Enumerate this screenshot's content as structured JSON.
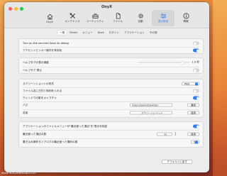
{
  "window": {
    "title": "OnyX"
  },
  "colors": {
    "close": "#ff5f57",
    "minimize": "#febc2e",
    "zoom": "#28c840",
    "accent": "#2e7df6"
  },
  "toolbar": {
    "items": [
      {
        "label": "OnyX",
        "icon": "house-icon"
      },
      {
        "label": "メンテナンス",
        "icon": "tools-icon"
      },
      {
        "label": "ユーティリティ",
        "icon": "toolbox-icon"
      },
      {
        "label": "ファイル",
        "icon": "document-icon"
      },
      {
        "label": "自動",
        "icon": "gear-icon"
      },
      {
        "label": "表示設定",
        "icon": "sliders-icon",
        "selected": true
      },
      {
        "label": "情報",
        "icon": "info-icon"
      }
    ]
  },
  "tabs": [
    {
      "label": "一般",
      "active": true
    },
    {
      "label": "Finder"
    },
    {
      "label": "メニュー"
    },
    {
      "label": "Dock"
    },
    {
      "label": "ログイン"
    },
    {
      "label": "アプリケーション"
    },
    {
      "label": "その他"
    }
  ],
  "section1": {
    "show_secured_label": "Turn on the secured Save As dialog",
    "color_picker_label": "アクセントピッカー値外を有効化",
    "show_secured_on": false,
    "color_picker_on": true
  },
  "section2": {
    "hide_delay_label": "ヘルプタグの表示速度",
    "hide_delay_value": "1.0 秒",
    "hide_delay_level": 0.88,
    "help_viewer_label": "ヘルプタグ 停止",
    "help_viewer_on": false
  },
  "section3": {
    "format_label": "スクリーンショットの形式",
    "format_value": "PNG",
    "include_date_label": "ファイル名に日付と時刻を入れる",
    "include_date_on": false,
    "shadow_label": "ウインドウの影をキャプチャ",
    "shadow_on": true,
    "path_label": "パス",
    "path_value": "/Users/Sams/Desktop/",
    "path_button": "選択",
    "name_label": "名前",
    "name_value": "スクリーンショット",
    "name_button": "適用"
  },
  "section4": {
    "app_menu_label": "アプリケーションのファイルメニューが\"最近使った項目\"を\"表示を指定",
    "app_menu_on": true,
    "recent_items_label": "最近使った項目の数",
    "recent_items_value": "10",
    "recent_items_button": "適用",
    "last_label": "書き込み操作ダイアログの最近使った場所の数",
    "last_value": "5"
  },
  "footer": {
    "defaults_button": "デフォルトに戻す",
    "watermark": "www.MacDownload.com"
  }
}
